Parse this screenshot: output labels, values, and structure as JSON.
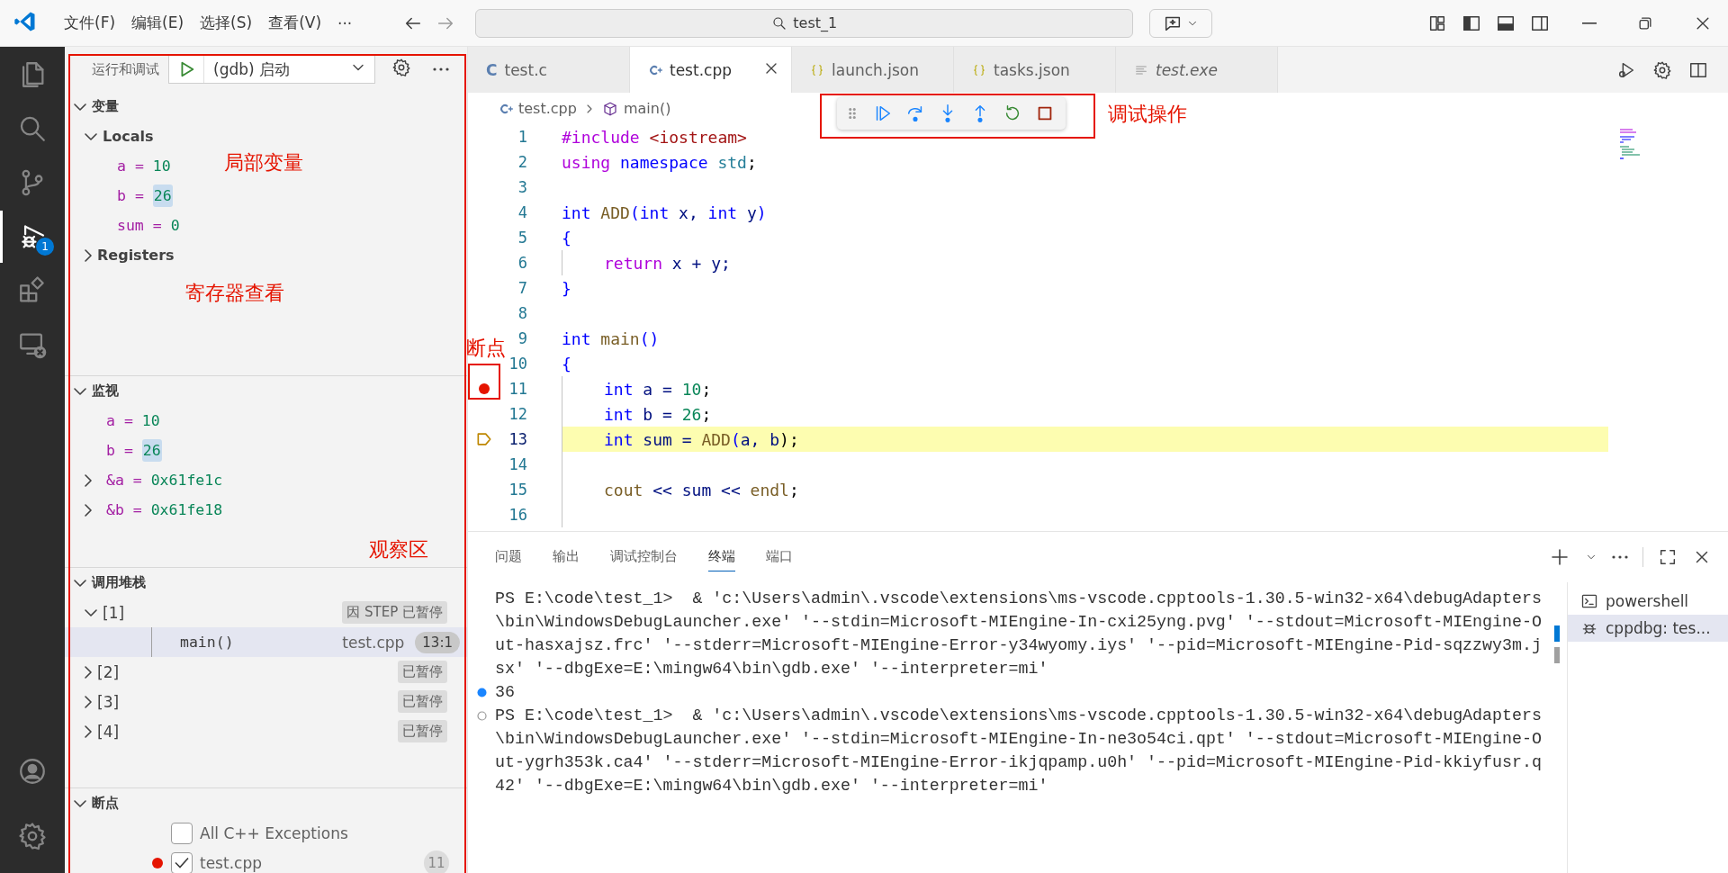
{
  "title_bar": {
    "menus": [
      "文件(F)",
      "编辑(E)",
      "选择(S)",
      "查看(V)",
      "···"
    ],
    "search": "test_1"
  },
  "activity_bar": {
    "items": [
      {
        "kind": "explorer",
        "selected": false
      },
      {
        "kind": "search",
        "selected": false
      },
      {
        "kind": "source-control",
        "selected": false
      },
      {
        "kind": "debug",
        "selected": true,
        "badge": "1"
      },
      {
        "kind": "extensions",
        "selected": false
      },
      {
        "kind": "remote",
        "selected": false
      }
    ],
    "bottom": [
      {
        "kind": "account"
      },
      {
        "kind": "settings"
      }
    ]
  },
  "sidebar": {
    "title": "运行和调试",
    "config": "(gdb) 启动",
    "variables": {
      "title": "变量",
      "expanded": true,
      "scopes": [
        {
          "name": "Locals",
          "expanded": true,
          "children": [
            {
              "name": "a",
              "sep": "=",
              "value": "10",
              "changed": false
            },
            {
              "name": "b",
              "sep": "=",
              "value": "26",
              "changed": true
            },
            {
              "name": "sum",
              "sep": "=",
              "value": "0",
              "changed": false
            }
          ]
        },
        {
          "name": "Registers",
          "expanded": false
        }
      ]
    },
    "watch": {
      "title": "监视",
      "expanded": true,
      "items": [
        {
          "name": "a",
          "sep": "=",
          "value": "10",
          "kind": "leaf",
          "changed": false
        },
        {
          "name": "b",
          "sep": "=",
          "value": "26",
          "kind": "leaf",
          "changed": true
        },
        {
          "name": "&a",
          "sep": "=",
          "value": "0x61fe1c",
          "kind": "group",
          "changed": false,
          "expanded": false
        },
        {
          "name": "&b",
          "sep": "=",
          "value": "0x61fe18",
          "kind": "group",
          "changed": false,
          "expanded": false
        }
      ]
    },
    "call_stack": {
      "title": "调用堆栈",
      "expanded": true,
      "threads": [
        {
          "name": "[1]",
          "status": "因 STEP 已暂停",
          "expanded": true,
          "frames": [
            {
              "name": "main()",
              "file": "test.cpp",
              "position": "13:1",
              "selected": true
            }
          ]
        },
        {
          "name": "[2]",
          "status": "已暂停",
          "expanded": false
        },
        {
          "name": "[3]",
          "status": "已暂停",
          "expanded": false
        },
        {
          "name": "[4]",
          "status": "已暂停",
          "expanded": false
        }
      ]
    },
    "breakpoints": {
      "title": "断点",
      "expanded": true,
      "items": [
        {
          "label": "All C++ Exceptions",
          "kind": "exception",
          "checked": false
        },
        {
          "label": "test.cpp",
          "kind": "source",
          "checked": true,
          "line": "11"
        }
      ]
    }
  },
  "editor": {
    "tabs": [
      {
        "label": "test.c",
        "kind": "c",
        "icon": "C",
        "selected": false,
        "preview": false
      },
      {
        "label": "test.cpp",
        "kind": "cpp",
        "selected": true,
        "preview": false
      },
      {
        "label": "launch.json",
        "kind": "json",
        "selected": false,
        "preview": false
      },
      {
        "label": "tasks.json",
        "kind": "json",
        "selected": false,
        "preview": false
      },
      {
        "label": "test.exe",
        "kind": "text",
        "selected": false,
        "preview": true
      }
    ],
    "breadcrumb": [
      "test.cpp",
      "main()"
    ],
    "debug_toolbar": [
      {
        "kind": "continue"
      },
      {
        "kind": "step-over"
      },
      {
        "kind": "step-into"
      },
      {
        "kind": "step-out"
      },
      {
        "kind": "restart"
      },
      {
        "kind": "stop"
      }
    ],
    "lines": [
      {
        "number": "1",
        "indented": false,
        "breakpoint": false,
        "current": false,
        "tokens": [
          {
            "text": "#include",
            "kind": "pre"
          },
          {
            "text": " <iostream>",
            "kind": "str"
          }
        ]
      },
      {
        "number": "2",
        "indented": false,
        "breakpoint": false,
        "current": false,
        "tokens": [
          {
            "text": "using",
            "kind": "ctl"
          },
          {
            "text": " namespace",
            "kind": "kw"
          },
          {
            "text": " std",
            "kind": "type"
          },
          {
            "text": ";",
            "kind": "plain"
          }
        ]
      },
      {
        "number": "3",
        "indented": false,
        "breakpoint": false,
        "current": false
      },
      {
        "number": "4",
        "indented": false,
        "breakpoint": false,
        "current": false,
        "tokens": [
          {
            "text": "int",
            "kind": "kw"
          },
          {
            "text": " ADD",
            "kind": "fn"
          },
          {
            "text": "(",
            "kind": "kw"
          },
          {
            "text": "int",
            "kind": "kw"
          },
          {
            "text": " x, ",
            "kind": "var"
          },
          {
            "text": "int",
            "kind": "kw"
          },
          {
            "text": " y",
            "kind": "var"
          },
          {
            "text": ")",
            "kind": "kw"
          }
        ]
      },
      {
        "number": "5",
        "indented": false,
        "breakpoint": false,
        "current": false,
        "tokens": [
          {
            "text": "{",
            "kind": "kw"
          }
        ]
      },
      {
        "number": "6",
        "indented": true,
        "breakpoint": false,
        "current": false,
        "tokens": [
          {
            "text": "return",
            "kind": "ctl"
          },
          {
            "text": " x + y;",
            "kind": "var"
          }
        ]
      },
      {
        "number": "7",
        "indented": false,
        "breakpoint": false,
        "current": false,
        "tokens": [
          {
            "text": "}",
            "kind": "kw"
          }
        ]
      },
      {
        "number": "8",
        "indented": false,
        "breakpoint": false,
        "current": false
      },
      {
        "number": "9",
        "indented": false,
        "breakpoint": false,
        "current": false,
        "tokens": [
          {
            "text": "int",
            "kind": "kw"
          },
          {
            "text": " main",
            "kind": "fn"
          },
          {
            "text": "()",
            "kind": "kw"
          }
        ]
      },
      {
        "number": "10",
        "indented": false,
        "breakpoint": false,
        "current": false,
        "tokens": [
          {
            "text": "{",
            "kind": "kw"
          }
        ]
      },
      {
        "number": "11",
        "indented": true,
        "breakpoint": true,
        "current": false,
        "tokens": [
          {
            "text": "int",
            "kind": "kw"
          },
          {
            "text": " a = ",
            "kind": "var"
          },
          {
            "text": "10",
            "kind": "num"
          },
          {
            "text": ";",
            "kind": "plain"
          }
        ]
      },
      {
        "number": "12",
        "indented": true,
        "breakpoint": false,
        "current": false,
        "tokens": [
          {
            "text": "int",
            "kind": "kw"
          },
          {
            "text": " b = ",
            "kind": "var"
          },
          {
            "text": "26",
            "kind": "num"
          },
          {
            "text": ";",
            "kind": "plain"
          }
        ]
      },
      {
        "number": "13",
        "indented": true,
        "breakpoint": false,
        "current": true,
        "tokens": [
          {
            "text": "int",
            "kind": "kw"
          },
          {
            "text": " sum = ",
            "kind": "var"
          },
          {
            "text": "ADD",
            "kind": "fn"
          },
          {
            "text": "(",
            "kind": "kw"
          },
          {
            "text": "a, b",
            "kind": "var"
          },
          {
            "text": ");",
            "kind": "plain"
          }
        ]
      },
      {
        "number": "14",
        "indented": true,
        "breakpoint": false,
        "current": false
      },
      {
        "number": "15",
        "indented": true,
        "breakpoint": false,
        "current": false,
        "tokens": [
          {
            "text": "cout",
            "kind": "fn"
          },
          {
            "text": " << sum << ",
            "kind": "var"
          },
          {
            "text": "endl",
            "kind": "fn"
          },
          {
            "text": ";",
            "kind": "plain"
          }
        ]
      },
      {
        "number": "16",
        "indented": true,
        "breakpoint": false,
        "current": false
      }
    ]
  },
  "panel": {
    "tabs": [
      {
        "label": "问题",
        "selected": false
      },
      {
        "label": "输出",
        "selected": false
      },
      {
        "label": "调试控制台",
        "selected": false
      },
      {
        "label": "终端",
        "selected": true
      },
      {
        "label": "端口",
        "selected": false
      }
    ],
    "terminal": [
      {
        "text": "PS E:\\code\\test_1>  & 'c:\\Users\\admin\\.vscode\\extensions\\ms-vscode.cpptools-1.30.5-win32-x64\\debugAdapters"
      },
      {
        "text": "\\bin\\WindowsDebugLauncher.exe' '--stdin=Microsoft-MIEngine-In-cxi25yng.pvg' '--stdout=Microsoft-MIEngine-O"
      },
      {
        "text": "ut-hasxajsz.frc' '--stderr=Microsoft-MIEngine-Error-y34wyomy.iys' '--pid=Microsoft-MIEngine-Pid-sqzzwy3m.j"
      },
      {
        "text": "sx' '--dbgExe=E:\\mingw64\\bin\\gdb.exe' '--interpreter=mi'"
      },
      {
        "text": "36",
        "kind": "success"
      },
      {
        "text": "PS E:\\code\\test_1>  & 'c:\\Users\\admin\\.vscode\\extensions\\ms-vscode.cpptools-1.30.5-win32-x64\\debugAdapters",
        "kind": "running"
      },
      {
        "text": "\\bin\\WindowsDebugLauncher.exe' '--stdin=Microsoft-MIEngine-In-ne3o54ci.qpt' '--stdout=Microsoft-MIEngine-O"
      },
      {
        "text": "ut-ygrh353k.ca4' '--stderr=Microsoft-MIEngine-Error-ikjqpamp.u0h' '--pid=Microsoft-MIEngine-Pid-kkiyfusr.q"
      },
      {
        "text": "42' '--dbgExe=E:\\mingw64\\bin\\gdb.exe' '--interpreter=mi'"
      }
    ],
    "terminals": [
      {
        "label": "powershell",
        "kind": "shell",
        "selected": false
      },
      {
        "label": "cppdbg: tes...",
        "kind": "debug",
        "selected": true
      }
    ]
  },
  "annotations": [
    {
      "text": "调试操作"
    },
    {
      "text": "断点"
    },
    {
      "text": "局部变量"
    },
    {
      "text": "寄存器查看"
    },
    {
      "text": "观察区"
    }
  ]
}
